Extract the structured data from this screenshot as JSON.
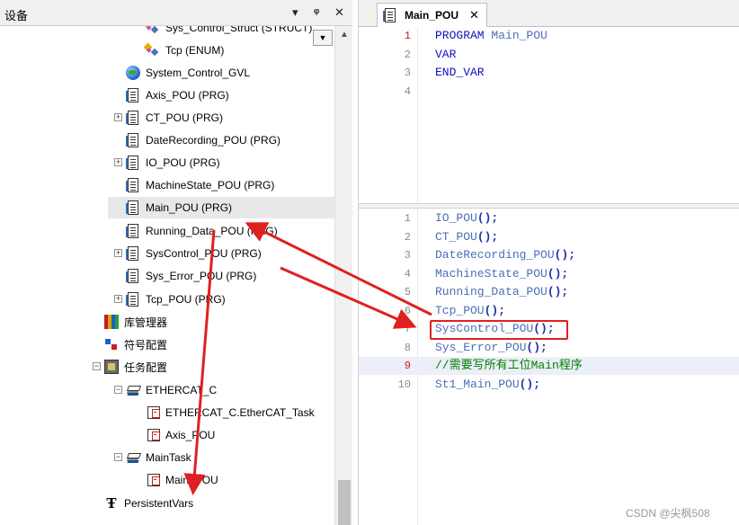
{
  "left_panel": {
    "title": "设备",
    "controls": {
      "pin": "▾",
      "autohide": "ᛘ",
      "close": "✕"
    },
    "tree": [
      {
        "label": "Sys_Control_Struct (STRUCT)",
        "icon": "struct-icon"
      },
      {
        "label": "Tcp (ENUM)",
        "icon": "enum-icon"
      },
      {
        "label": "System_Control_GVL",
        "icon": "globe-icon"
      },
      {
        "label": "Axis_POU (PRG)",
        "icon": "pou-icon"
      },
      {
        "label": "CT_POU (PRG)",
        "icon": "pou-icon",
        "expander": "+"
      },
      {
        "label": "DateRecording_POU (PRG)",
        "icon": "pou-icon"
      },
      {
        "label": "IO_POU (PRG)",
        "icon": "pou-icon",
        "expander": "+"
      },
      {
        "label": "MachineState_POU (PRG)",
        "icon": "pou-icon"
      },
      {
        "label": "Main_POU (PRG)",
        "icon": "pou-icon",
        "selected": true
      },
      {
        "label": "Running_Data_POU (PRG)",
        "icon": "pou-icon"
      },
      {
        "label": "SysControl_POU (PRG)",
        "icon": "pou-icon",
        "expander": "+"
      },
      {
        "label": "Sys_Error_POU (PRG)",
        "icon": "pou-icon"
      },
      {
        "label": "Tcp_POU (PRG)",
        "icon": "pou-icon",
        "expander": "+"
      },
      {
        "label": "库管理器",
        "icon": "library-icon"
      },
      {
        "label": "符号配置",
        "icon": "symbol-config-icon"
      },
      {
        "label": "任务配置",
        "icon": "task-config-icon",
        "expander": "−"
      },
      {
        "label": "ETHERCAT_C",
        "icon": "task-icon",
        "expander": "−"
      },
      {
        "label": "ETHERCAT_C.EtherCAT_Task",
        "icon": "task-call-icon"
      },
      {
        "label": "Axis_POU",
        "icon": "task-call-icon"
      },
      {
        "label": "MainTask",
        "icon": "task-icon",
        "expander": "−"
      },
      {
        "label": "Main_POU",
        "icon": "task-call-icon"
      },
      {
        "label": "PersistentVars",
        "icon": "persistent-vars-icon"
      }
    ]
  },
  "editor": {
    "tab_label": "Main_POU",
    "tab_close": "✕",
    "declaration": [
      {
        "n": "1",
        "text": "PROGRAM Main_POU"
      },
      {
        "n": "2",
        "text": "VAR"
      },
      {
        "n": "3",
        "text": "END_VAR"
      },
      {
        "n": "4",
        "text": ""
      }
    ],
    "body": [
      {
        "n": "1",
        "text": "IO_POU();"
      },
      {
        "n": "2",
        "text": "CT_POU();"
      },
      {
        "n": "3",
        "text": "DateRecording_POU();"
      },
      {
        "n": "4",
        "text": "MachineState_POU();"
      },
      {
        "n": "5",
        "text": "Running_Data_POU();"
      },
      {
        "n": "6",
        "text": "Tcp_POU();"
      },
      {
        "n": "7",
        "text": "SysControl_POU();"
      },
      {
        "n": "8",
        "text": "Sys_Error_POU();"
      },
      {
        "n": "9",
        "text": "//需要写所有工位Main程序"
      },
      {
        "n": "10",
        "text": "St1_Main_POU();"
      }
    ]
  },
  "watermark": "CSDN @尖枫508",
  "colors": {
    "annotation_red": "#e02020",
    "keyword_blue": "#1010c0",
    "comment_green": "#008000"
  }
}
